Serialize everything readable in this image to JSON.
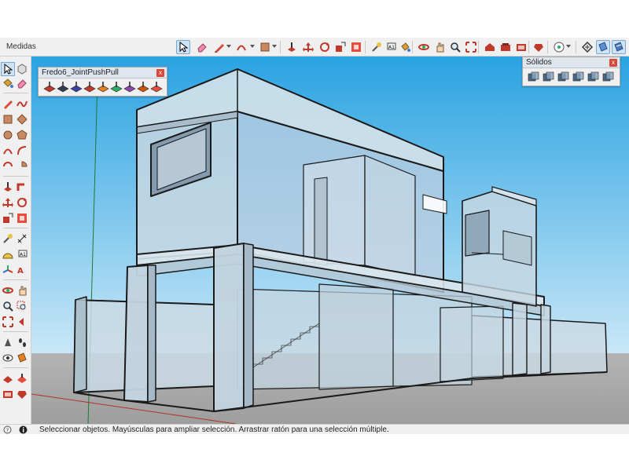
{
  "toolbar": {
    "measure_label": "Medidas",
    "tools": [
      "select-arrow",
      "eraser",
      "pencil-line",
      "arc",
      "rectangle",
      "push-pull",
      "move",
      "rotate",
      "scale",
      "offset",
      "tape-measure",
      "text-label",
      "paint-bucket",
      "orbit",
      "pan",
      "zoom",
      "zoom-extents",
      "warehouse",
      "extension-manager",
      "layout",
      "model-info",
      "geo-location",
      "solid-tools",
      "section"
    ]
  },
  "left_toolbar": {
    "tools": [
      "select",
      "paint",
      "line",
      "freehand",
      "rectangle",
      "rotated-rectangle",
      "circle",
      "polygon",
      "arc",
      "pie",
      "push-pull",
      "follow-me",
      "move",
      "rotate",
      "scale",
      "offset",
      "tape",
      "dimension",
      "protractor",
      "text",
      "axes",
      "3d-text",
      "orbit",
      "pan",
      "zoom",
      "zoom-window",
      "previous",
      "zoom-extents",
      "position-camera",
      "walk",
      "look-around",
      "section-plane",
      "sandbox-a",
      "sandbox-b",
      "extension-a",
      "extension-b"
    ]
  },
  "plugins": {
    "fredo": {
      "title": "Fredo6_JointPushPull",
      "close": "x",
      "buttons": [
        {
          "name": "jpp-joint-icon",
          "color": "#c0392b",
          "letter": ""
        },
        {
          "name": "jpp-1-icon",
          "color": "#2c3e50",
          "letter": "1"
        },
        {
          "name": "jpp-2-icon",
          "color": "#3b3fa8",
          "letter": "="
        },
        {
          "name": "jpp-3-icon",
          "color": "#c0392b",
          "letter": "J"
        },
        {
          "name": "jpp-4-icon",
          "color": "#e67e22",
          "letter": "V"
        },
        {
          "name": "jpp-5-icon",
          "color": "#27ae60",
          "letter": "N"
        },
        {
          "name": "jpp-6-icon",
          "color": "#8e44ad",
          "letter": "E"
        },
        {
          "name": "jpp-7-icon",
          "color": "#d35400",
          "letter": "T"
        },
        {
          "name": "jpp-8-icon",
          "color": "#e74c3c",
          "letter": "F"
        }
      ]
    },
    "solidos": {
      "title": "Sólidos",
      "close": "x",
      "buttons": [
        "outer-shell-icon",
        "intersect-icon",
        "union-icon",
        "subtract-icon",
        "trim-icon",
        "split-icon"
      ]
    }
  },
  "status": {
    "text": "Seleccionar objetos. Mayúsculas para ampliar selección. Arrastrar ratón para una selección múltiple."
  },
  "colors": {
    "sky_top": "#2aa3e2",
    "sky_bottom": "#c9e7f7",
    "ground": "#a9a9a9",
    "glass": "#c7d7e2",
    "edge": "#1a1a1a",
    "accent_select": "#7aa7d6"
  }
}
